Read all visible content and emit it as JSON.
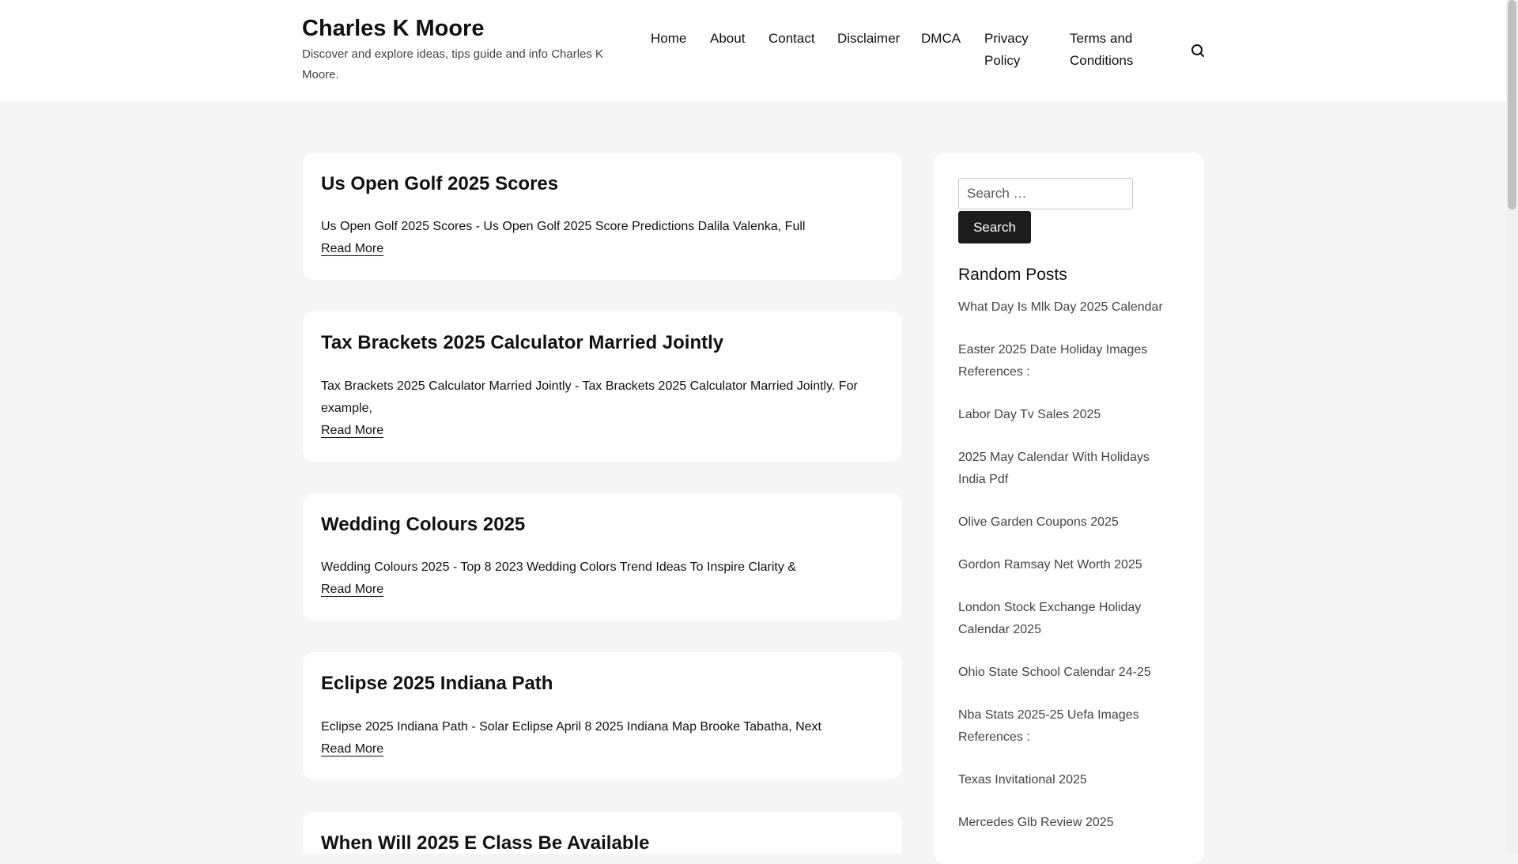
{
  "site": {
    "title": "Charles K Moore",
    "description": "Discover and explore ideas, tips guide and info Charles K Moore."
  },
  "nav": {
    "items": [
      "Home",
      "About",
      "Contact",
      "Disclaimer",
      "DMCA",
      "Privacy Policy",
      "Terms and Conditions"
    ],
    "search_icon": "search-icon"
  },
  "posts": [
    {
      "title": "Us Open Golf 2025 Scores",
      "excerpt": "Us Open Golf 2025 Scores - Us Open Golf 2025 Score Predictions Dalila Valenka, Full",
      "more": "Read More"
    },
    {
      "title": "Tax Brackets 2025 Calculator Married Jointly",
      "excerpt": "Tax Brackets 2025 Calculator Married Jointly - Tax Brackets 2025 Calculator Married Jointly. For example,",
      "more": "Read More"
    },
    {
      "title": "Wedding Colours 2025",
      "excerpt": "Wedding Colours 2025 - Top 8 2023 Wedding Colors Trend Ideas To Inspire Clarity &",
      "more": "Read More"
    },
    {
      "title": "Eclipse 2025 Indiana Path",
      "excerpt": "Eclipse 2025 Indiana Path - Solar Eclipse April 8 2025 Indiana Map Brooke Tabatha, Next",
      "more": "Read More"
    },
    {
      "title": "When Will 2025 E Class Be Available"
    }
  ],
  "sidebar": {
    "search_placeholder": "Search …",
    "search_button": "Search",
    "random_title": "Random Posts",
    "random_posts": [
      "What Day Is Mlk Day 2025 Calendar",
      "Easter 2025 Date Holiday Images References :",
      "Labor Day Tv Sales 2025",
      "2025 May Calendar With Holidays India Pdf",
      "Olive Garden Coupons 2025",
      "Gordon Ramsay Net Worth 2025",
      "London Stock Exchange Holiday Calendar 2025",
      "Ohio State School Calendar 24-25",
      "Nba Stats 2025-25 Uefa Images References :",
      "Texas Invitational 2025",
      "Mercedes Glb Review 2025"
    ]
  }
}
